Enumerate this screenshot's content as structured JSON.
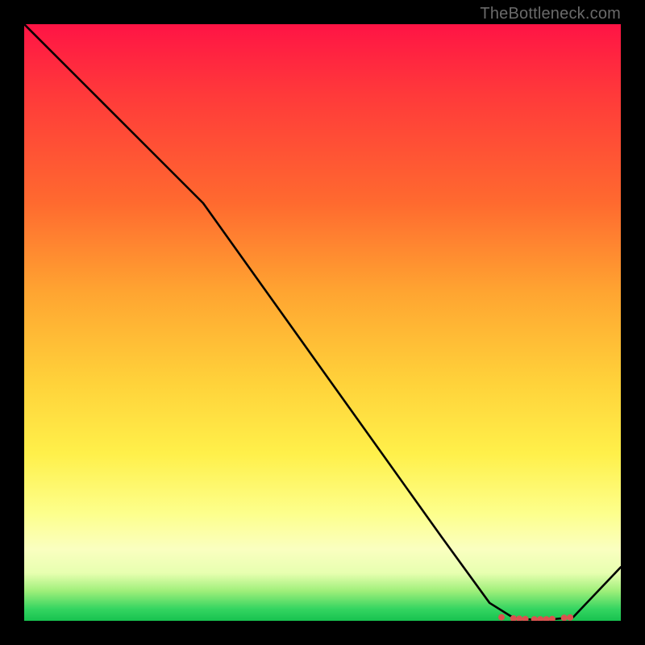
{
  "attribution": "TheBottleneck.com",
  "chart_data": {
    "type": "line",
    "title": "",
    "xlabel": "",
    "ylabel": "",
    "xlim": [
      0,
      100
    ],
    "ylim": [
      0,
      100
    ],
    "grid": false,
    "legend": false,
    "series": [
      {
        "name": "curve",
        "x": [
          0,
          10,
          20,
          30,
          40,
          50,
          60,
          70,
          78,
          82,
          85,
          88,
          92,
          100
        ],
        "y": [
          100,
          90,
          80,
          70,
          56,
          42,
          28,
          14,
          3,
          0.5,
          0.2,
          0.2,
          0.6,
          9
        ],
        "color": "#000000"
      }
    ],
    "markers": {
      "name": "bottom-dots",
      "x": [
        80,
        82,
        83,
        84,
        85.5,
        86.5,
        87.5,
        88.5,
        90.5,
        91.5
      ],
      "y": [
        0.6,
        0.4,
        0.35,
        0.3,
        0.25,
        0.25,
        0.25,
        0.3,
        0.5,
        0.55
      ],
      "color": "#d9534f",
      "size": 4
    },
    "gradient_stops": [
      {
        "pos": 0,
        "color": "#ff1445"
      },
      {
        "pos": 12,
        "color": "#ff3a3a"
      },
      {
        "pos": 30,
        "color": "#ff6a2f"
      },
      {
        "pos": 45,
        "color": "#ffa531"
      },
      {
        "pos": 60,
        "color": "#ffd23a"
      },
      {
        "pos": 72,
        "color": "#fff04a"
      },
      {
        "pos": 82,
        "color": "#fdff8c"
      },
      {
        "pos": 88,
        "color": "#faffc0"
      },
      {
        "pos": 92,
        "color": "#e7ffb0"
      },
      {
        "pos": 95,
        "color": "#9fef7a"
      },
      {
        "pos": 98,
        "color": "#35d561"
      },
      {
        "pos": 100,
        "color": "#17c24f"
      }
    ]
  }
}
